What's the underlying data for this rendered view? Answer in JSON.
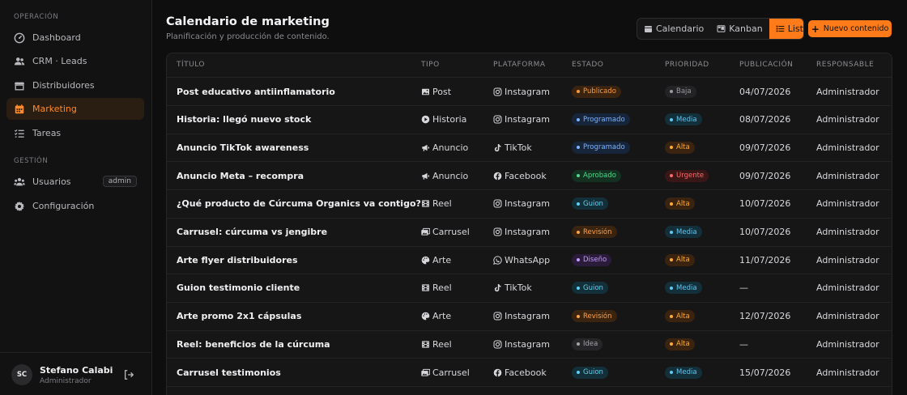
{
  "sidebar": {
    "section_operacion": "OPERACIÓN",
    "section_gestion": "GESTIÓN",
    "items": [
      {
        "label": "Dashboard",
        "icon": "dashboard-icon"
      },
      {
        "label": "CRM · Leads",
        "icon": "users-icon"
      },
      {
        "label": "Distribuidores",
        "icon": "store-icon"
      },
      {
        "label": "Marketing",
        "icon": "calendar-icon"
      },
      {
        "label": "Tareas",
        "icon": "tasks-icon"
      },
      {
        "label": "Usuarios",
        "icon": "users-group-icon",
        "badge": "admin"
      },
      {
        "label": "Configuración",
        "icon": "gear-icon"
      }
    ],
    "user": {
      "initials": "SC",
      "name": "Stefano Calabi",
      "role": "Administrador"
    }
  },
  "header": {
    "title": "Calendario de marketing",
    "subtitle": "Planificación y producción de contenido.",
    "views": [
      "Calendario",
      "Kanban",
      "Lista"
    ],
    "active_view": "Lista",
    "new_button": "Nuevo contenido"
  },
  "table": {
    "columns": [
      "TÍTULO",
      "TIPO",
      "PLATAFORMA",
      "ESTADO",
      "PRIORIDAD",
      "PUBLICACIÓN",
      "RESPONSABLE"
    ],
    "rows": [
      {
        "titulo": "Post educativo antiinflamatorio",
        "tipo": "Post",
        "plataforma": "Instagram",
        "estado": "Publicado",
        "prioridad": "Baja",
        "publicacion": "04/07/2026",
        "responsable": "Administrador"
      },
      {
        "titulo": "Historia: llegó nuevo stock",
        "tipo": "Historia",
        "plataforma": "Instagram",
        "estado": "Programado",
        "prioridad": "Media",
        "publicacion": "08/07/2026",
        "responsable": "Administrador"
      },
      {
        "titulo": "Anuncio TikTok awareness",
        "tipo": "Anuncio",
        "plataforma": "TikTok",
        "estado": "Programado",
        "prioridad": "Alta",
        "publicacion": "09/07/2026",
        "responsable": "Administrador"
      },
      {
        "titulo": "Anuncio Meta – recompra",
        "tipo": "Anuncio",
        "plataforma": "Facebook",
        "estado": "Aprobado",
        "prioridad": "Urgente",
        "publicacion": "09/07/2026",
        "responsable": "Administrador"
      },
      {
        "titulo": "¿Qué producto de Cúrcuma Organics va contigo?",
        "tipo": "Reel",
        "plataforma": "Instagram",
        "estado": "Guion",
        "prioridad": "Alta",
        "publicacion": "10/07/2026",
        "responsable": "Administrador"
      },
      {
        "titulo": "Carrusel: cúrcuma vs jengibre",
        "tipo": "Carrusel",
        "plataforma": "Instagram",
        "estado": "Revisión",
        "prioridad": "Media",
        "publicacion": "10/07/2026",
        "responsable": "Administrador"
      },
      {
        "titulo": "Arte flyer distribuidores",
        "tipo": "Arte",
        "plataforma": "WhatsApp",
        "estado": "Diseño",
        "prioridad": "Alta",
        "publicacion": "11/07/2026",
        "responsable": "Administrador"
      },
      {
        "titulo": "Guion testimonio cliente",
        "tipo": "Reel",
        "plataforma": "TikTok",
        "estado": "Guion",
        "prioridad": "Media",
        "publicacion": "—",
        "responsable": "Administrador"
      },
      {
        "titulo": "Arte promo 2x1 cápsulas",
        "tipo": "Arte",
        "plataforma": "Instagram",
        "estado": "Revisión",
        "prioridad": "Alta",
        "publicacion": "12/07/2026",
        "responsable": "Administrador"
      },
      {
        "titulo": "Reel: beneficios de la cúrcuma",
        "tipo": "Reel",
        "plataforma": "Instagram",
        "estado": "Idea",
        "prioridad": "Alta",
        "publicacion": "—",
        "responsable": "Administrador"
      },
      {
        "titulo": "Carrusel testimonios",
        "tipo": "Carrusel",
        "plataforma": "Facebook",
        "estado": "Guion",
        "prioridad": "Media",
        "publicacion": "15/07/2026",
        "responsable": "Administrador"
      }
    ]
  },
  "colors": {
    "accent": "#ff7a18",
    "estado": {
      "Publicado": {
        "bg": "#3a2410",
        "fg": "#ff9a3c"
      },
      "Programado": {
        "bg": "#16253a",
        "fg": "#7fb3ff"
      },
      "Aprobado": {
        "bg": "#133021",
        "fg": "#4fd98a"
      },
      "Guion": {
        "bg": "#13303a",
        "fg": "#5fd1f0"
      },
      "Revisión": {
        "bg": "#3a2410",
        "fg": "#ffa24a"
      },
      "Diseño": {
        "bg": "#2a1c3a",
        "fg": "#c59bff"
      },
      "Idea": {
        "bg": "#262628",
        "fg": "#a5a5aa"
      }
    },
    "prioridad": {
      "Baja": {
        "bg": "#232325",
        "fg": "#9a9a9f"
      },
      "Media": {
        "bg": "#13303a",
        "fg": "#5fc8f5"
      },
      "Alta": {
        "bg": "#3a2410",
        "fg": "#ffab3a"
      },
      "Urgente": {
        "bg": "#3a1616",
        "fg": "#ff6b6b"
      }
    }
  }
}
